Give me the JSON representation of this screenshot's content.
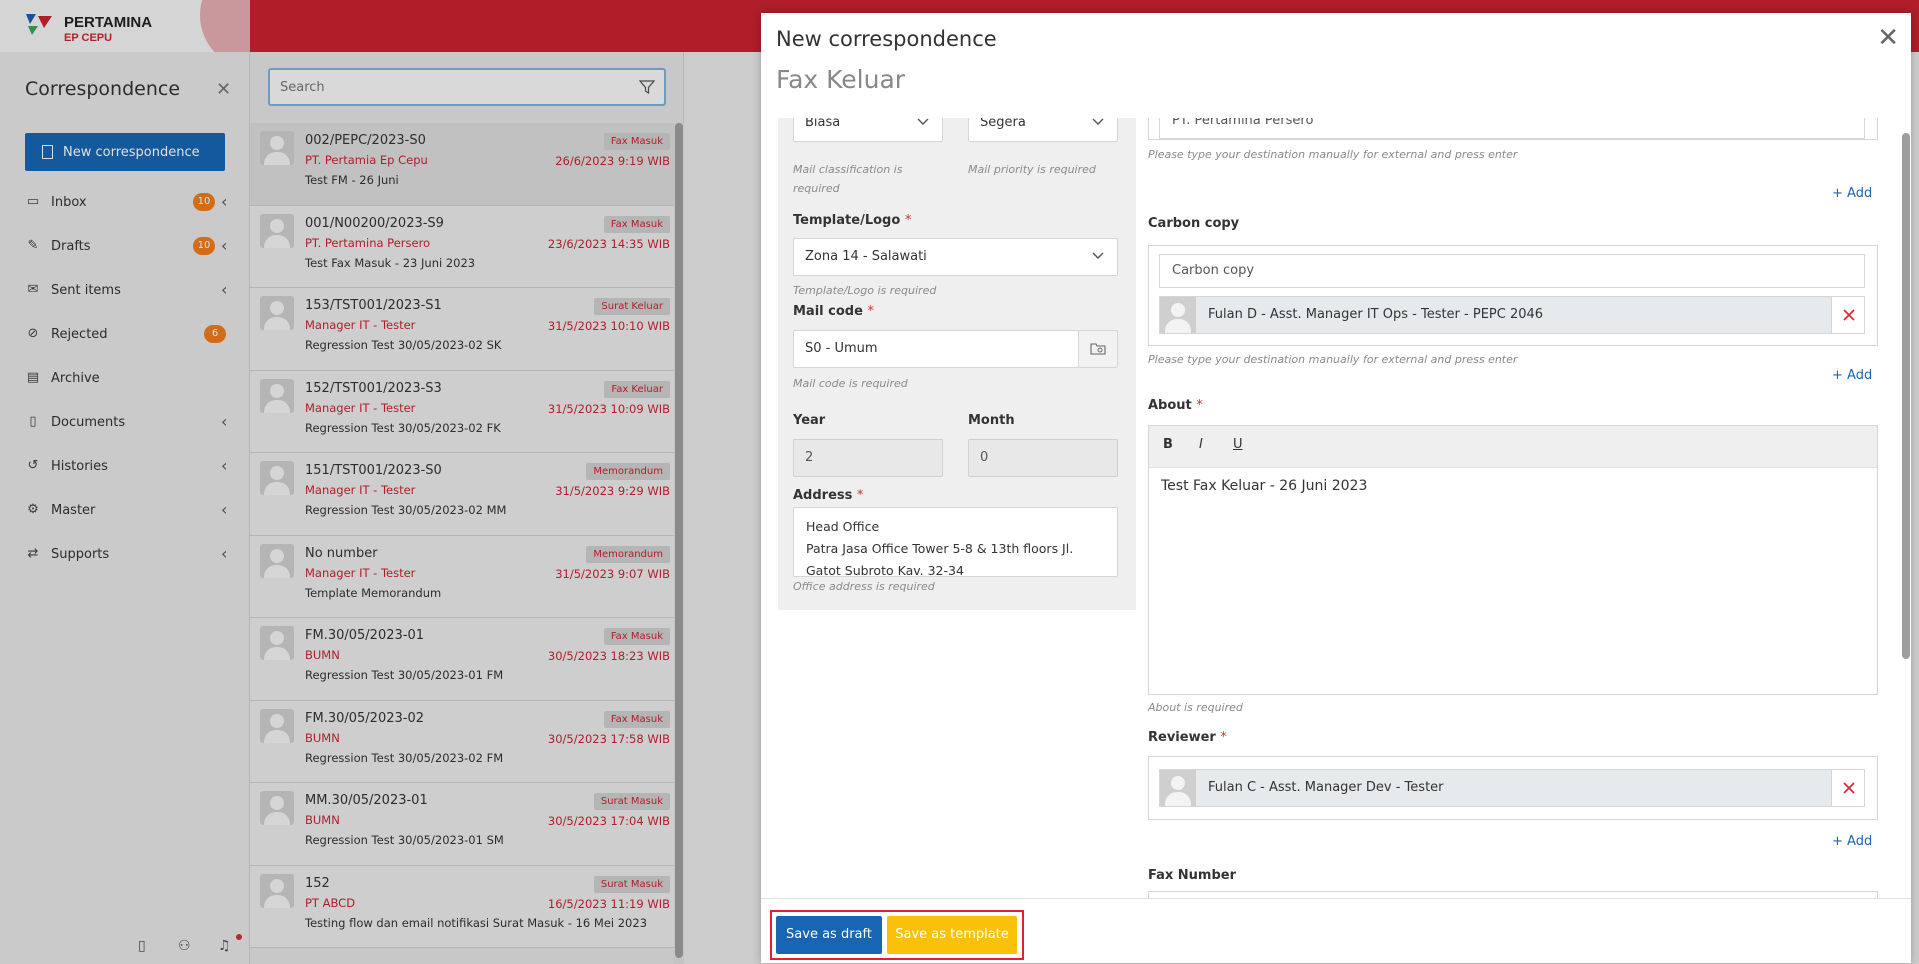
{
  "brand": {
    "name": "PERTAMINA",
    "sub": "EP CEPU"
  },
  "sidebar": {
    "title": "Correspondence",
    "new_button": "New correspondence",
    "items": [
      {
        "label": "Inbox",
        "icon": "inbox-icon",
        "badge": "10",
        "chevron": true
      },
      {
        "label": "Drafts",
        "icon": "drafts-icon",
        "badge": "10",
        "chevron": true
      },
      {
        "label": "Sent items",
        "icon": "sent-icon",
        "badge": "",
        "chevron": true
      },
      {
        "label": "Rejected",
        "icon": "rejected-icon",
        "badge": "6",
        "chevron": false
      },
      {
        "label": "Archive",
        "icon": "archive-icon",
        "badge": "",
        "chevron": false
      },
      {
        "label": "Documents",
        "icon": "documents-icon",
        "badge": "",
        "chevron": true
      },
      {
        "label": "Histories",
        "icon": "history-icon",
        "badge": "",
        "chevron": true
      },
      {
        "label": "Master",
        "icon": "master-icon",
        "badge": "",
        "chevron": true
      },
      {
        "label": "Supports",
        "icon": "supports-icon",
        "badge": "",
        "chevron": true
      }
    ]
  },
  "search": {
    "placeholder": "Search"
  },
  "mails": [
    {
      "number": "002/PEPC/2023-S0",
      "sender": "PT. Pertamia Ep Cepu",
      "subject": "Test FM - 26 Juni",
      "type": "Fax Masuk",
      "date": "26/6/2023 9:19 WIB"
    },
    {
      "number": "001/N00200/2023-S9",
      "sender": "PT. Pertamina Persero",
      "subject": "Test Fax Masuk - 23 Juni 2023",
      "type": "Fax Masuk",
      "date": "23/6/2023 14:35 WIB"
    },
    {
      "number": "153/TST001/2023-S1",
      "sender": "Manager IT - Tester",
      "subject": "Regression Test 30/05/2023-02 SK",
      "type": "Surat Keluar",
      "date": "31/5/2023 10:10 WIB"
    },
    {
      "number": "152/TST001/2023-S3",
      "sender": "Manager IT - Tester",
      "subject": "Regression Test 30/05/2023-02 FK",
      "type": "Fax Keluar",
      "date": "31/5/2023 10:09 WIB"
    },
    {
      "number": "151/TST001/2023-S0",
      "sender": "Manager IT - Tester",
      "subject": "Regression Test 30/05/2023-02 MM",
      "type": "Memorandum",
      "date": "31/5/2023 9:29 WIB"
    },
    {
      "number": "No number",
      "sender": "Manager IT - Tester",
      "subject": "Template Memorandum",
      "type": "Memorandum",
      "date": "31/5/2023 9:07 WIB"
    },
    {
      "number": "FM.30/05/2023-01",
      "sender": "BUMN",
      "subject": "Regression Test 30/05/2023-01 FM",
      "type": "Fax Masuk",
      "date": "30/5/2023 18:23 WIB"
    },
    {
      "number": "FM.30/05/2023-02",
      "sender": "BUMN",
      "subject": "Regression Test 30/05/2023-02 FM",
      "type": "Fax Masuk",
      "date": "30/5/2023 17:58 WIB"
    },
    {
      "number": "MM.30/05/2023-01",
      "sender": "BUMN",
      "subject": "Regression Test 30/05/2023-01 SM",
      "type": "Surat Masuk",
      "date": "30/5/2023 17:04 WIB"
    },
    {
      "number": "152",
      "sender": "PT ABCD",
      "subject": "Testing flow dan email notifikasi Surat Masuk - 16 Mei 2023",
      "type": "Surat Masuk",
      "date": "16/5/2023 11:19 WIB"
    }
  ],
  "modal": {
    "title": "New correspondence",
    "subtitle": "Fax Keluar",
    "classification": {
      "value": "Biasa",
      "hint": "Mail classification is required"
    },
    "priority": {
      "value": "Segera",
      "hint": "Mail priority is required"
    },
    "template": {
      "label": "Template/Logo",
      "value": "Zona 14 - Salawati",
      "hint": "Template/Logo is required"
    },
    "mail_code": {
      "label": "Mail code",
      "value": "S0 - Umum",
      "hint": "Mail code is required"
    },
    "year": {
      "label": "Year",
      "value": "2"
    },
    "month": {
      "label": "Month",
      "value": "0"
    },
    "address": {
      "label": "Address",
      "line1": "Head Office",
      "line2": "Patra Jasa Office Tower 5-8 & 13th floors Jl.",
      "line3": "Gatot Subroto Kav. 32-34",
      "hint": "Office address is required"
    },
    "destination": {
      "value": "PT. Pertamina Persero",
      "hint": "Please type your destination manually for external and press enter",
      "add": "Add"
    },
    "cc": {
      "label": "Carbon copy",
      "placeholder": "Carbon copy",
      "chip": "Fulan D - Asst. Manager IT Ops - Tester - PEPC 2046",
      "hint": "Please type your destination manually for external and press enter",
      "add": "Add"
    },
    "about": {
      "label": "About",
      "bold": "B",
      "italic": "I",
      "underline": "U",
      "text": "Test Fax Keluar - 26 Juni 2023",
      "hint": "About is required"
    },
    "reviewer": {
      "label": "Reviewer",
      "chip": "Fulan C - Asst. Manager Dev - Tester",
      "add": "Add"
    },
    "fax_number": {
      "label": "Fax Number"
    },
    "buttons": {
      "draft": "Save as draft",
      "template": "Save as template"
    }
  },
  "colors": {
    "brand_red": "#c8232f",
    "primary": "#1765b3",
    "warning": "#fbc10a",
    "badge": "#f07d1a",
    "highlight": "#e5202e"
  }
}
